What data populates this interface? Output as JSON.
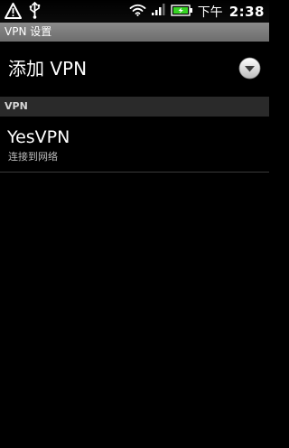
{
  "status_bar": {
    "icons": [
      "warning-icon",
      "usb-icon",
      "wifi-icon",
      "signal-icon",
      "battery-charging-icon"
    ],
    "ampm": "下午",
    "time": "2:38"
  },
  "title_bar": {
    "title": "VPN 设置"
  },
  "add_vpn": {
    "label": "添加 VPN",
    "icon": "chevron-down-circle-icon"
  },
  "section": {
    "header": "VPN"
  },
  "vpn_list": [
    {
      "name": "YesVPN",
      "status": "连接到网络"
    }
  ],
  "colors": {
    "background": "#000000",
    "title_bar": "#7a7a7a",
    "section_header": "#2a2a2a",
    "secondary_text": "#bdbdbd"
  }
}
